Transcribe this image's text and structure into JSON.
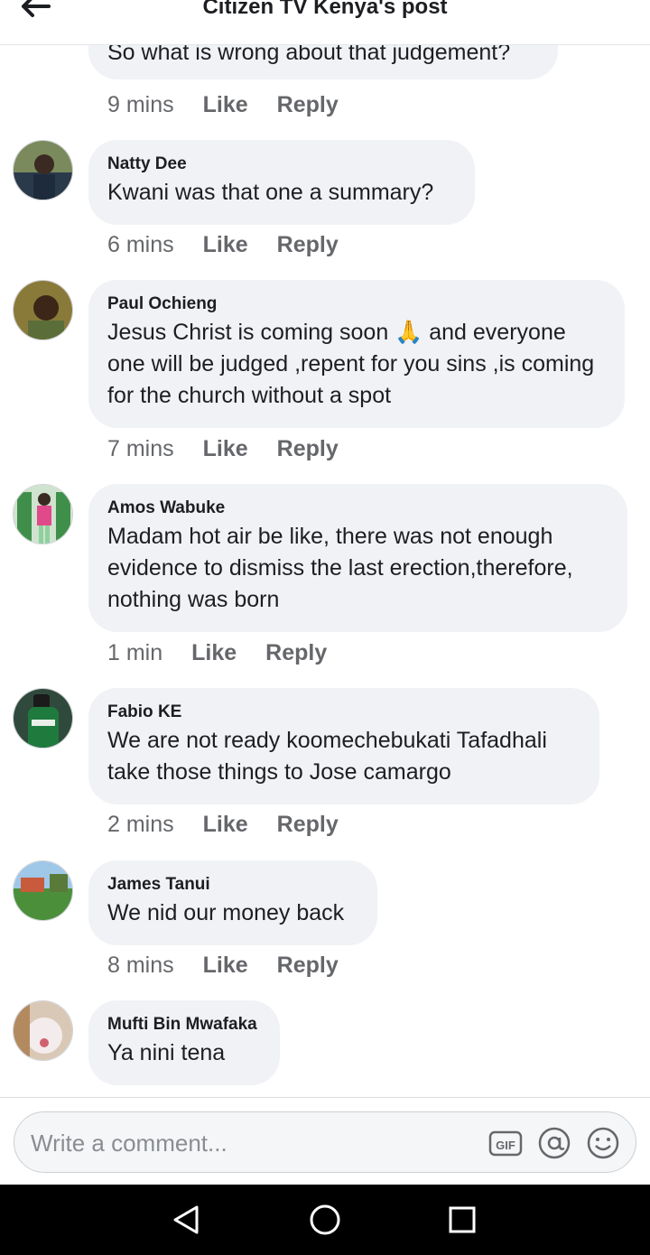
{
  "header": {
    "title": "Citizen TV Kenya's post",
    "back_icon": "arrow-left-icon"
  },
  "actions": {
    "like": "Like",
    "reply": "Reply"
  },
  "comments": [
    {
      "author": "",
      "text": "So what is wrong about that judgement?",
      "time": "9 mins"
    },
    {
      "author": "Natty Dee",
      "text": "Kwani was that one a summary?",
      "time": "6 mins"
    },
    {
      "author": "Paul Ochieng",
      "text": "Jesus Christ is coming soon 🙏  and everyone one will be judged ,repent for you sins ,is coming for the church without a spot",
      "time": "7 mins"
    },
    {
      "author": "Amos Wabuke",
      "text": "Madam hot air be like, there was not enough evidence to dismiss the last erection,therefore, nothing was born",
      "time": "1 min"
    },
    {
      "author": "Fabio KE",
      "text": "We are not ready koomechebukati Tafadhali take those things to Jose camargo",
      "time": "2 mins"
    },
    {
      "author": "James Tanui",
      "text": "We nid our money back",
      "time": "8 mins"
    },
    {
      "author": "Mufti Bin Mwafaka",
      "text": "Ya nini tena",
      "time": ""
    }
  ],
  "composer": {
    "placeholder": "Write a comment...",
    "gif_icon": "gif-icon",
    "mention_icon": "at-mention-icon",
    "emoji_icon": "emoji-smile-icon"
  },
  "nav": {
    "back": "triangle-back-icon",
    "home": "circle-home-icon",
    "recents": "square-recents-icon"
  },
  "colors": {
    "bubble": "#f0f2f5",
    "meta": "#65676b",
    "text": "#1c1e21",
    "navbar": "#000000"
  }
}
